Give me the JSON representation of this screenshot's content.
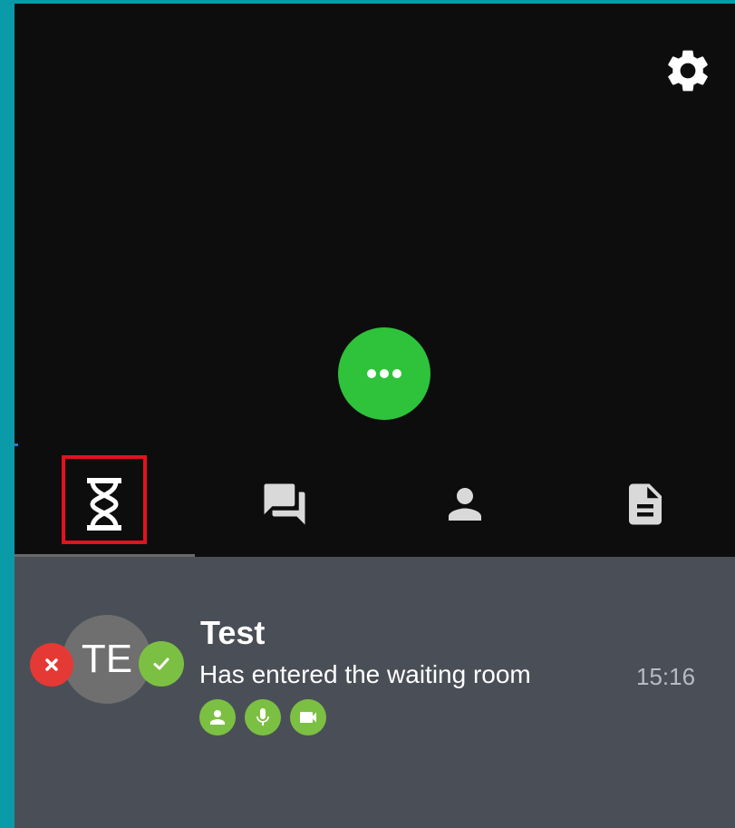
{
  "icons": {
    "settings": "gear-icon",
    "more": "more-horizontal-icon",
    "tabs": [
      "hourglass-icon",
      "chat-icon",
      "person-icon",
      "document-icon"
    ],
    "reject": "close-icon",
    "accept": "check-icon",
    "permissions": [
      "person-icon",
      "microphone-icon",
      "camera-icon"
    ]
  },
  "colors": {
    "outer_background": "#0b9aa8",
    "app_background": "#0d0d0d",
    "accent_green": "#2ec33a",
    "permission_green": "#7cc043",
    "reject_red": "#e53935",
    "highlight_red": "#e3121d",
    "panel_background": "#4a4f57"
  },
  "tabs": {
    "active_index": 0
  },
  "waiting_room": {
    "participant": {
      "initials": "TE",
      "name": "Test",
      "status": "Has entered the waiting room",
      "time": "15:16"
    }
  }
}
